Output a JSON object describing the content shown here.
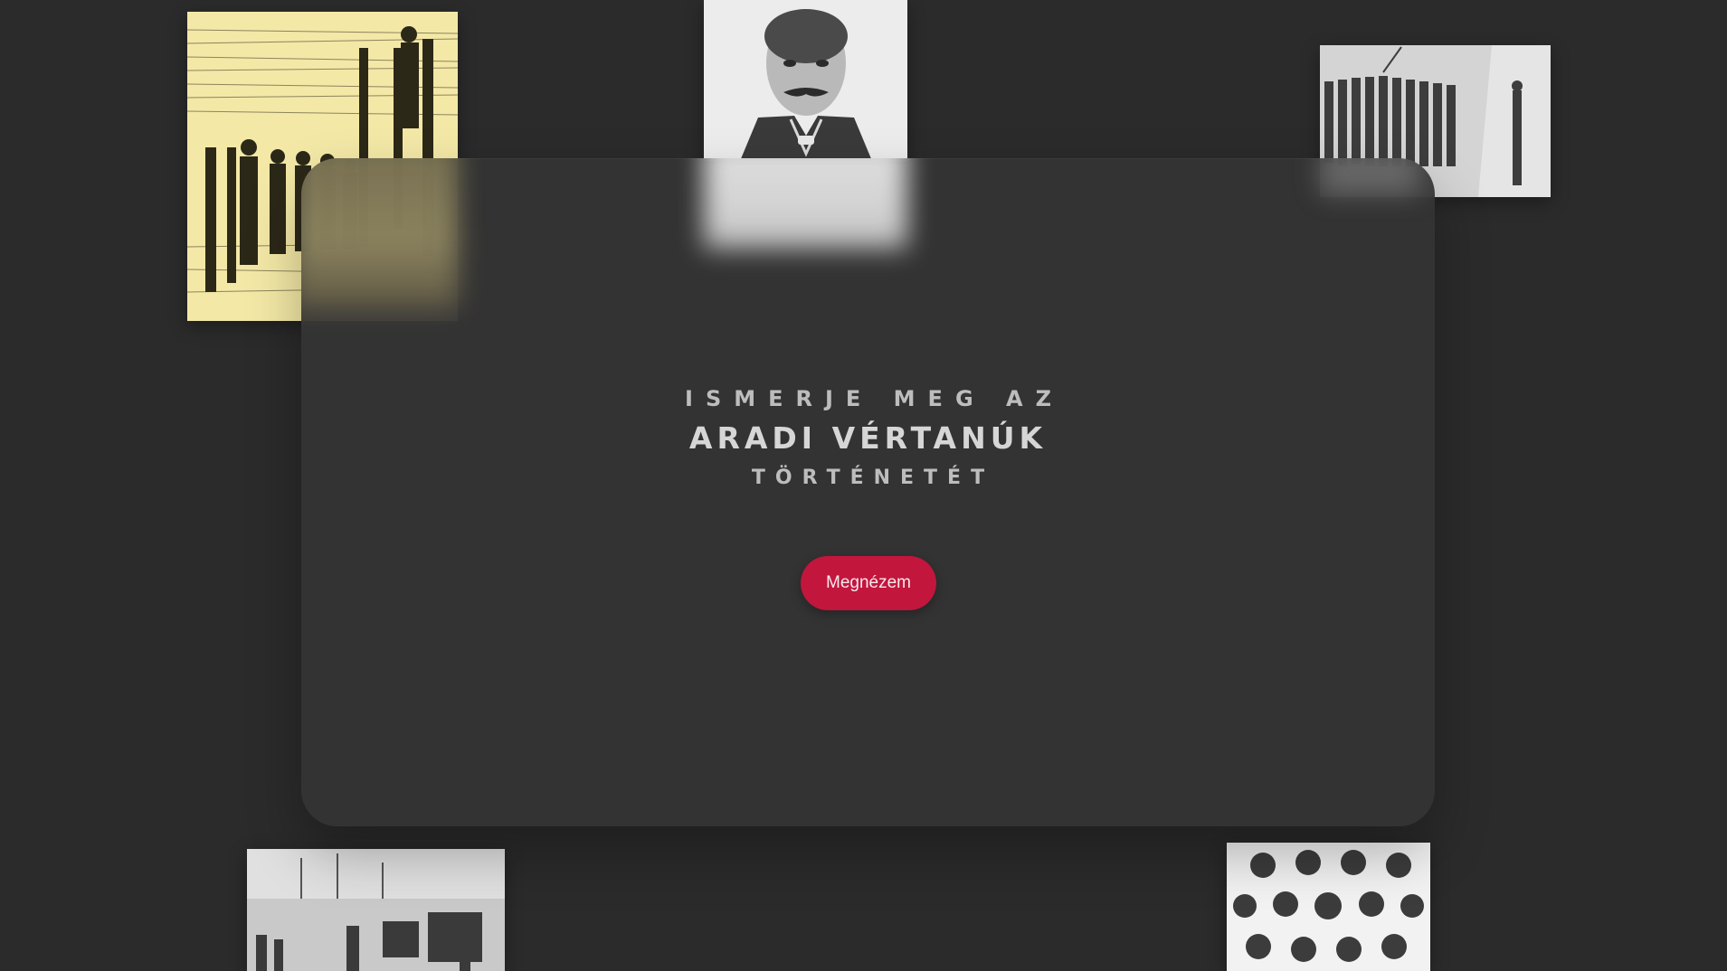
{
  "hero": {
    "line1": "ISMERJE MEG AZ",
    "line2": "ARADI VÉRTANÚK",
    "line3": "TÖRTÉNETÉT"
  },
  "cta": {
    "label": "Megnézem"
  },
  "colors": {
    "background": "#2b2b2b",
    "card": "#343434",
    "accent": "#c2163d"
  },
  "images": [
    {
      "name": "execution-engraving-yellow",
      "icon": "engraving-image"
    },
    {
      "name": "officer-portrait",
      "icon": "portrait-image"
    },
    {
      "name": "firing-squad",
      "icon": "engraving-image"
    },
    {
      "name": "execution-crowd",
      "icon": "engraving-image"
    },
    {
      "name": "martyrs-group-portrait",
      "icon": "portrait-grid-image"
    }
  ]
}
